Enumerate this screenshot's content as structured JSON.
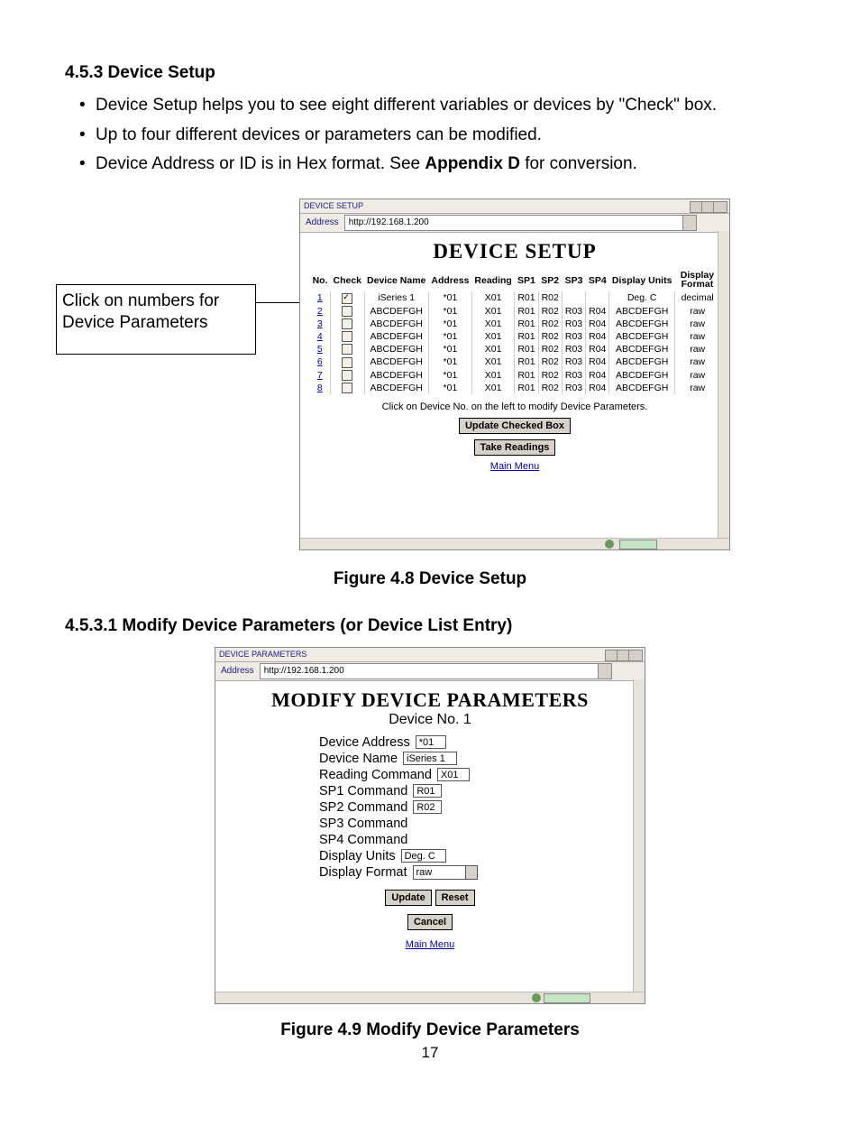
{
  "section": {
    "head1": "4.5.3 Device Setup",
    "bullets": [
      "Device Setup helps you to see eight different variables or devices by \"Check\" box.",
      "Up to four different devices or parameters can be modified.",
      {
        "pre": "Device Address or ID is in Hex format.  See ",
        "bold": "Appendix D",
        "post": " for conversion."
      }
    ],
    "head2": "4.5.3.1 Modify Device Parameters (or Device List Entry)"
  },
  "callout": "Click on numbers for Device Parameters",
  "fig1": {
    "title": "DEVICE SETUP",
    "page_h": "DEVICE SETUP",
    "address_lbl": "Address",
    "address_url": "http://192.168.1.200",
    "tbl": {
      "headers": [
        "No.",
        "Check",
        "Device Name",
        "Address",
        "Reading",
        "SP1",
        "SP2",
        "SP3",
        "SP4",
        "Display Units",
        "Display Format"
      ],
      "rows": [
        {
          "no": "1",
          "chk": true,
          "name": "iSeries 1",
          "addr": "*01",
          "read": "X01",
          "sp1": "R01",
          "sp2": "R02",
          "sp3": "",
          "sp4": "",
          "units": "Deg. C",
          "fmt": "decimal"
        },
        {
          "no": "2",
          "chk": false,
          "name": "ABCDEFGH",
          "addr": "*01",
          "read": "X01",
          "sp1": "R01",
          "sp2": "R02",
          "sp3": "R03",
          "sp4": "R04",
          "units": "ABCDEFGH",
          "fmt": "raw"
        },
        {
          "no": "3",
          "chk": false,
          "name": "ABCDEFGH",
          "addr": "*01",
          "read": "X01",
          "sp1": "R01",
          "sp2": "R02",
          "sp3": "R03",
          "sp4": "R04",
          "units": "ABCDEFGH",
          "fmt": "raw"
        },
        {
          "no": "4",
          "chk": false,
          "name": "ABCDEFGH",
          "addr": "*01",
          "read": "X01",
          "sp1": "R01",
          "sp2": "R02",
          "sp3": "R03",
          "sp4": "R04",
          "units": "ABCDEFGH",
          "fmt": "raw"
        },
        {
          "no": "5",
          "chk": false,
          "name": "ABCDEFGH",
          "addr": "*01",
          "read": "X01",
          "sp1": "R01",
          "sp2": "R02",
          "sp3": "R03",
          "sp4": "R04",
          "units": "ABCDEFGH",
          "fmt": "raw"
        },
        {
          "no": "6",
          "chk": false,
          "name": "ABCDEFGH",
          "addr": "*01",
          "read": "X01",
          "sp1": "R01",
          "sp2": "R02",
          "sp3": "R03",
          "sp4": "R04",
          "units": "ABCDEFGH",
          "fmt": "raw"
        },
        {
          "no": "7",
          "chk": false,
          "name": "ABCDEFGH",
          "addr": "*01",
          "read": "X01",
          "sp1": "R01",
          "sp2": "R02",
          "sp3": "R03",
          "sp4": "R04",
          "units": "ABCDEFGH",
          "fmt": "raw"
        },
        {
          "no": "8",
          "chk": false,
          "name": "ABCDEFGH",
          "addr": "*01",
          "read": "X01",
          "sp1": "R01",
          "sp2": "R02",
          "sp3": "R03",
          "sp4": "R04",
          "units": "ABCDEFGH",
          "fmt": "raw"
        }
      ]
    },
    "hint": "Click on Device No. on the left to modify Device Parameters.",
    "btn_update": "Update Checked Box",
    "btn_take": "Take Readings",
    "main_menu": "Main Menu",
    "caption": "Figure 4.8  Device Setup"
  },
  "fig2": {
    "title": "DEVICE PARAMETERS",
    "page_h": "MODIFY DEVICE PARAMETERS",
    "sub": "Device No. 1",
    "address_lbl": "Address",
    "address_url": "http://192.168.1.200",
    "fields": {
      "addr_l": "Device Address",
      "addr_v": "*01",
      "name_l": "Device Name",
      "name_v": "iSeries 1",
      "read_l": "Reading Command",
      "read_v": "X01",
      "sp1_l": "SP1 Command",
      "sp1_v": "R01",
      "sp2_l": "SP2 Command",
      "sp2_v": "R02",
      "sp3_l": "SP3 Command",
      "sp3_v": "",
      "sp4_l": "SP4 Command",
      "sp4_v": "",
      "units_l": "Display Units",
      "units_v": "Deg. C",
      "fmt_l": "Display Format",
      "fmt_v": "raw"
    },
    "btn_update": "Update",
    "btn_reset": "Reset",
    "btn_cancel": "Cancel",
    "main_menu": "Main Menu",
    "caption": "Figure 4.9  Modify Device Parameters"
  },
  "page_number": "17"
}
